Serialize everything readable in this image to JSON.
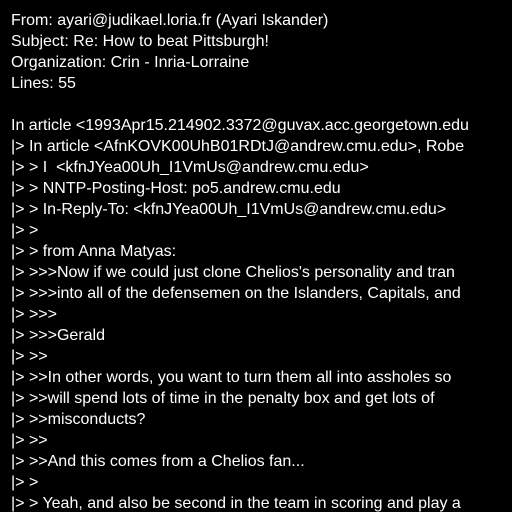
{
  "header": {
    "from": "From: ayari@judikael.loria.fr (Ayari Iskander)",
    "subject": "Subject: Re: How to beat Pittsburgh!",
    "organization": "Organization: Crin - Inria-Lorraine",
    "lines": "Lines: 55"
  },
  "body": [
    "In article <1993Apr15.214902.3372@guvax.acc.georgetown.edu",
    "|> In article <AfnKOVK00UhB01RDtJ@andrew.cmu.edu>, Robe",
    "|> > I  <kfnJYea00Uh_I1VmUs@andrew.cmu.edu>",
    "|> > NNTP-Posting-Host: po5.andrew.cmu.edu",
    "|> > In-Reply-To: <kfnJYea00Uh_I1VmUs@andrew.cmu.edu>",
    "|> >",
    "|> > from Anna Matyas:",
    "|> >>>Now if we could just clone Chelios's personality and tran",
    "|> >>>into all of the defensemen on the Islanders, Capitals, and",
    "|> >>>",
    "|> >>>Gerald",
    "|> >>",
    "|> >>In other words, you want to turn them all into assholes so",
    "|> >>will spend lots of time in the penalty box and get lots of",
    "|> >>misconducts?",
    "|> >>",
    "|> >>And this comes from a Chelios fan...",
    "|> >",
    "|> > Yeah, and also be second in the team in scoring and play a"
  ]
}
